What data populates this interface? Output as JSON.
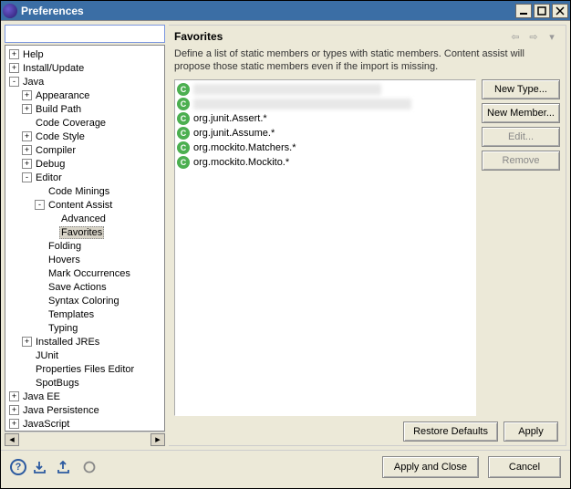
{
  "window": {
    "title": "Preferences"
  },
  "filter": {
    "value": "",
    "placeholder": ""
  },
  "tree": [
    {
      "label": "Help",
      "depth": 0,
      "exp": "+"
    },
    {
      "label": "Install/Update",
      "depth": 0,
      "exp": "+"
    },
    {
      "label": "Java",
      "depth": 0,
      "exp": "-"
    },
    {
      "label": "Appearance",
      "depth": 1,
      "exp": "+"
    },
    {
      "label": "Build Path",
      "depth": 1,
      "exp": "+"
    },
    {
      "label": "Code Coverage",
      "depth": 1,
      "exp": ""
    },
    {
      "label": "Code Style",
      "depth": 1,
      "exp": "+"
    },
    {
      "label": "Compiler",
      "depth": 1,
      "exp": "+"
    },
    {
      "label": "Debug",
      "depth": 1,
      "exp": "+"
    },
    {
      "label": "Editor",
      "depth": 1,
      "exp": "-"
    },
    {
      "label": "Code Minings",
      "depth": 2,
      "exp": ""
    },
    {
      "label": "Content Assist",
      "depth": 2,
      "exp": "-"
    },
    {
      "label": "Advanced",
      "depth": 3,
      "exp": ""
    },
    {
      "label": "Favorites",
      "depth": 3,
      "exp": "",
      "selected": true
    },
    {
      "label": "Folding",
      "depth": 2,
      "exp": ""
    },
    {
      "label": "Hovers",
      "depth": 2,
      "exp": ""
    },
    {
      "label": "Mark Occurrences",
      "depth": 2,
      "exp": ""
    },
    {
      "label": "Save Actions",
      "depth": 2,
      "exp": ""
    },
    {
      "label": "Syntax Coloring",
      "depth": 2,
      "exp": ""
    },
    {
      "label": "Templates",
      "depth": 2,
      "exp": ""
    },
    {
      "label": "Typing",
      "depth": 2,
      "exp": ""
    },
    {
      "label": "Installed JREs",
      "depth": 1,
      "exp": "+"
    },
    {
      "label": "JUnit",
      "depth": 1,
      "exp": ""
    },
    {
      "label": "Properties Files Editor",
      "depth": 1,
      "exp": ""
    },
    {
      "label": "SpotBugs",
      "depth": 1,
      "exp": ""
    },
    {
      "label": "Java EE",
      "depth": 0,
      "exp": "+"
    },
    {
      "label": "Java Persistence",
      "depth": 0,
      "exp": "+"
    },
    {
      "label": "JavaScript",
      "depth": 0,
      "exp": "+"
    }
  ],
  "page": {
    "title": "Favorites",
    "description": "Define a list of static members or types with static members. Content assist will propose those static members even if the import is missing."
  },
  "favorites": [
    {
      "text": "■■■■■■■■■■■■■■■■■■■■■■■■■■■■■■■",
      "blur": true
    },
    {
      "text": "■■■■■■■■■■■■■■■■■■■■■■■■■■■■■■■■■■■■",
      "blur": true
    },
    {
      "text": "org.junit.Assert.*"
    },
    {
      "text": "org.junit.Assume.*"
    },
    {
      "text": "org.mockito.Matchers.*"
    },
    {
      "text": "org.mockito.Mockito.*"
    }
  ],
  "buttons": {
    "newType": "New Type...",
    "newMember": "New Member...",
    "edit": "Edit...",
    "remove": "Remove",
    "restoreDefaults": "Restore Defaults",
    "apply": "Apply",
    "applyClose": "Apply and Close",
    "cancel": "Cancel"
  }
}
